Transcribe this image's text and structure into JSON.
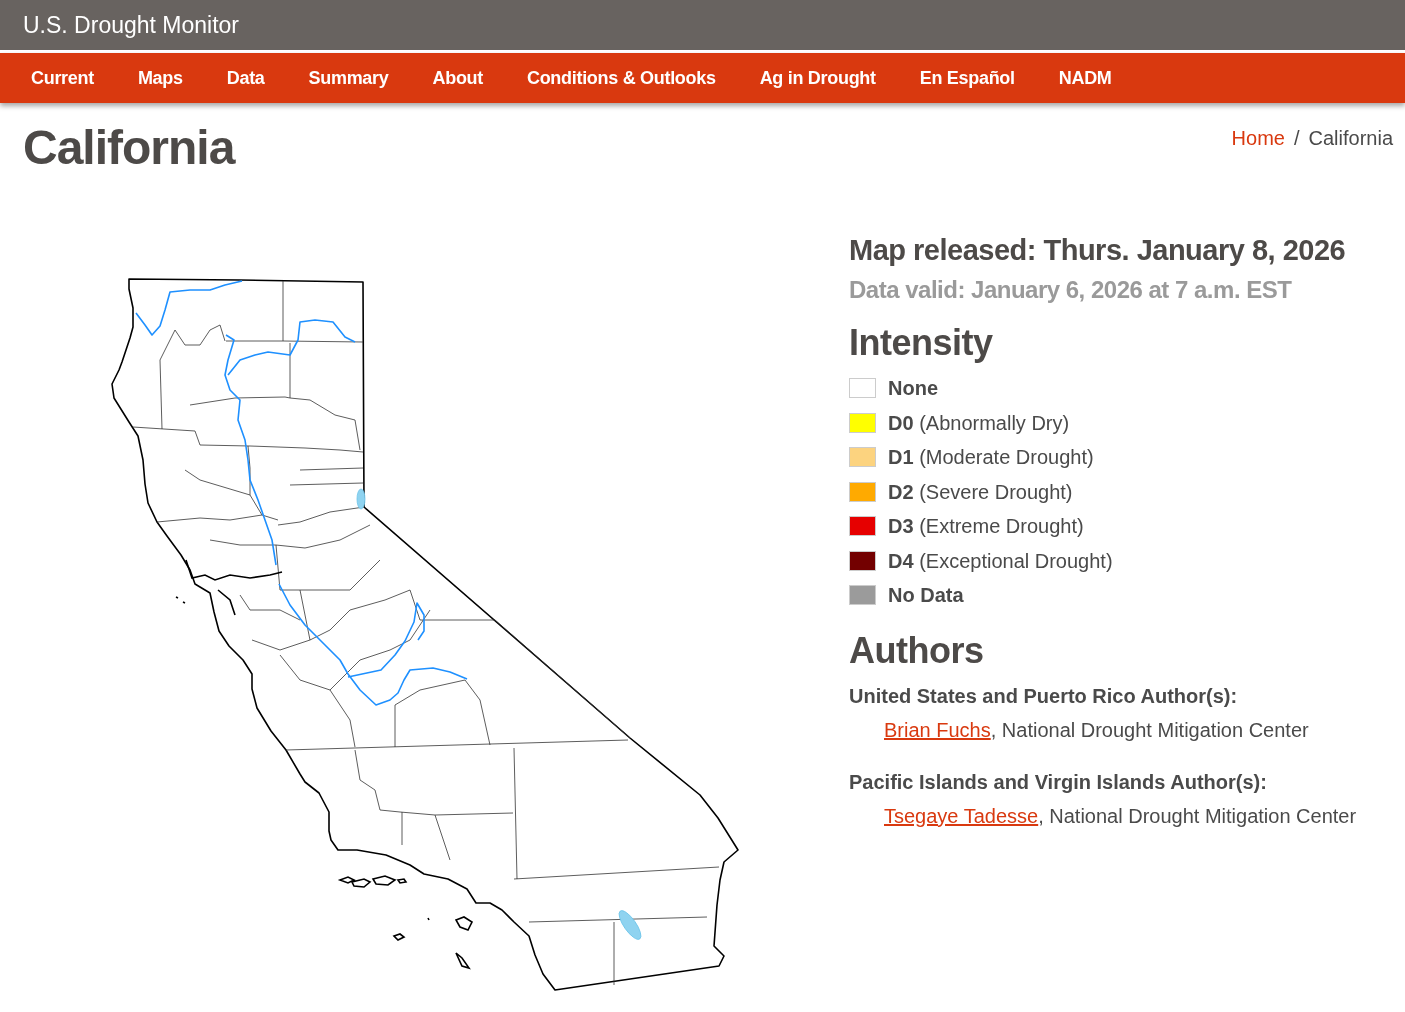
{
  "site": {
    "title": "U.S. Drought Monitor"
  },
  "nav": [
    {
      "label": "Current"
    },
    {
      "label": "Maps"
    },
    {
      "label": "Data"
    },
    {
      "label": "Summary"
    },
    {
      "label": "About"
    },
    {
      "label": "Conditions & Outlooks"
    },
    {
      "label": "Ag in Drought"
    },
    {
      "label": "En Español"
    },
    {
      "label": "NADM"
    }
  ],
  "page": {
    "title": "California"
  },
  "breadcrumb": {
    "separator": "/",
    "items": [
      {
        "label": "Home",
        "current": false
      },
      {
        "label": "California",
        "current": true
      }
    ]
  },
  "map_info": {
    "released": "Map released: Thurs. January 8, 2026",
    "valid": "Data valid: January 6, 2026 at 7 a.m. EST"
  },
  "legend": {
    "title": "Intensity",
    "items": [
      {
        "code": "None",
        "color": "#ffffff"
      },
      {
        "code": "D0",
        "description": "(Abnormally Dry)",
        "color": "#ffff00"
      },
      {
        "code": "D1",
        "description": "(Moderate Drought)",
        "color": "#fcd37f"
      },
      {
        "code": "D2",
        "description": "(Severe Drought)",
        "color": "#ffaa00"
      },
      {
        "code": "D3",
        "description": "(Extreme Drought)",
        "color": "#e60000"
      },
      {
        "code": "D4",
        "description": "(Exceptional Drought)",
        "color": "#730000"
      },
      {
        "code": "No Data",
        "color": "#9b9b9b"
      }
    ]
  },
  "authors": {
    "title": "Authors",
    "groups": [
      {
        "heading": "United States and Puerto Rico Author(s):",
        "entries": [
          {
            "name": "Brian Fuchs",
            "affiliation": ", National Drought Mitigation Center"
          }
        ]
      },
      {
        "heading": "Pacific Islands and Virgin Islands Author(s):",
        "entries": [
          {
            "name": "Tsegaye Tadesse",
            "affiliation": ", National Drought Mitigation Center"
          }
        ]
      }
    ]
  }
}
